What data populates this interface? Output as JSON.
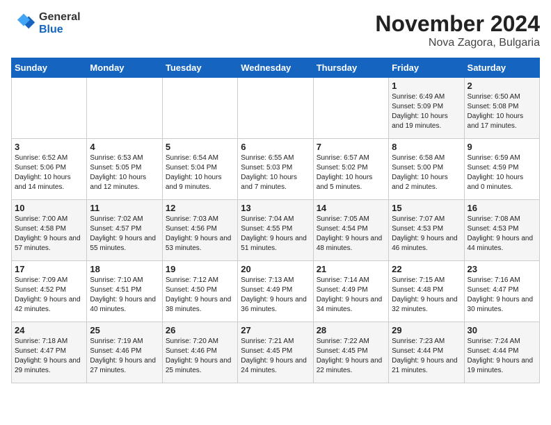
{
  "header": {
    "logo_general": "General",
    "logo_blue": "Blue",
    "month": "November 2024",
    "location": "Nova Zagora, Bulgaria"
  },
  "weekdays": [
    "Sunday",
    "Monday",
    "Tuesday",
    "Wednesday",
    "Thursday",
    "Friday",
    "Saturday"
  ],
  "weeks": [
    [
      {
        "day": "",
        "info": ""
      },
      {
        "day": "",
        "info": ""
      },
      {
        "day": "",
        "info": ""
      },
      {
        "day": "",
        "info": ""
      },
      {
        "day": "",
        "info": ""
      },
      {
        "day": "1",
        "info": "Sunrise: 6:49 AM\nSunset: 5:09 PM\nDaylight: 10 hours and 19 minutes."
      },
      {
        "day": "2",
        "info": "Sunrise: 6:50 AM\nSunset: 5:08 PM\nDaylight: 10 hours and 17 minutes."
      }
    ],
    [
      {
        "day": "3",
        "info": "Sunrise: 6:52 AM\nSunset: 5:06 PM\nDaylight: 10 hours and 14 minutes."
      },
      {
        "day": "4",
        "info": "Sunrise: 6:53 AM\nSunset: 5:05 PM\nDaylight: 10 hours and 12 minutes."
      },
      {
        "day": "5",
        "info": "Sunrise: 6:54 AM\nSunset: 5:04 PM\nDaylight: 10 hours and 9 minutes."
      },
      {
        "day": "6",
        "info": "Sunrise: 6:55 AM\nSunset: 5:03 PM\nDaylight: 10 hours and 7 minutes."
      },
      {
        "day": "7",
        "info": "Sunrise: 6:57 AM\nSunset: 5:02 PM\nDaylight: 10 hours and 5 minutes."
      },
      {
        "day": "8",
        "info": "Sunrise: 6:58 AM\nSunset: 5:00 PM\nDaylight: 10 hours and 2 minutes."
      },
      {
        "day": "9",
        "info": "Sunrise: 6:59 AM\nSunset: 4:59 PM\nDaylight: 10 hours and 0 minutes."
      }
    ],
    [
      {
        "day": "10",
        "info": "Sunrise: 7:00 AM\nSunset: 4:58 PM\nDaylight: 9 hours and 57 minutes."
      },
      {
        "day": "11",
        "info": "Sunrise: 7:02 AM\nSunset: 4:57 PM\nDaylight: 9 hours and 55 minutes."
      },
      {
        "day": "12",
        "info": "Sunrise: 7:03 AM\nSunset: 4:56 PM\nDaylight: 9 hours and 53 minutes."
      },
      {
        "day": "13",
        "info": "Sunrise: 7:04 AM\nSunset: 4:55 PM\nDaylight: 9 hours and 51 minutes."
      },
      {
        "day": "14",
        "info": "Sunrise: 7:05 AM\nSunset: 4:54 PM\nDaylight: 9 hours and 48 minutes."
      },
      {
        "day": "15",
        "info": "Sunrise: 7:07 AM\nSunset: 4:53 PM\nDaylight: 9 hours and 46 minutes."
      },
      {
        "day": "16",
        "info": "Sunrise: 7:08 AM\nSunset: 4:53 PM\nDaylight: 9 hours and 44 minutes."
      }
    ],
    [
      {
        "day": "17",
        "info": "Sunrise: 7:09 AM\nSunset: 4:52 PM\nDaylight: 9 hours and 42 minutes."
      },
      {
        "day": "18",
        "info": "Sunrise: 7:10 AM\nSunset: 4:51 PM\nDaylight: 9 hours and 40 minutes."
      },
      {
        "day": "19",
        "info": "Sunrise: 7:12 AM\nSunset: 4:50 PM\nDaylight: 9 hours and 38 minutes."
      },
      {
        "day": "20",
        "info": "Sunrise: 7:13 AM\nSunset: 4:49 PM\nDaylight: 9 hours and 36 minutes."
      },
      {
        "day": "21",
        "info": "Sunrise: 7:14 AM\nSunset: 4:49 PM\nDaylight: 9 hours and 34 minutes."
      },
      {
        "day": "22",
        "info": "Sunrise: 7:15 AM\nSunset: 4:48 PM\nDaylight: 9 hours and 32 minutes."
      },
      {
        "day": "23",
        "info": "Sunrise: 7:16 AM\nSunset: 4:47 PM\nDaylight: 9 hours and 30 minutes."
      }
    ],
    [
      {
        "day": "24",
        "info": "Sunrise: 7:18 AM\nSunset: 4:47 PM\nDaylight: 9 hours and 29 minutes."
      },
      {
        "day": "25",
        "info": "Sunrise: 7:19 AM\nSunset: 4:46 PM\nDaylight: 9 hours and 27 minutes."
      },
      {
        "day": "26",
        "info": "Sunrise: 7:20 AM\nSunset: 4:46 PM\nDaylight: 9 hours and 25 minutes."
      },
      {
        "day": "27",
        "info": "Sunrise: 7:21 AM\nSunset: 4:45 PM\nDaylight: 9 hours and 24 minutes."
      },
      {
        "day": "28",
        "info": "Sunrise: 7:22 AM\nSunset: 4:45 PM\nDaylight: 9 hours and 22 minutes."
      },
      {
        "day": "29",
        "info": "Sunrise: 7:23 AM\nSunset: 4:44 PM\nDaylight: 9 hours and 21 minutes."
      },
      {
        "day": "30",
        "info": "Sunrise: 7:24 AM\nSunset: 4:44 PM\nDaylight: 9 hours and 19 minutes."
      }
    ]
  ]
}
